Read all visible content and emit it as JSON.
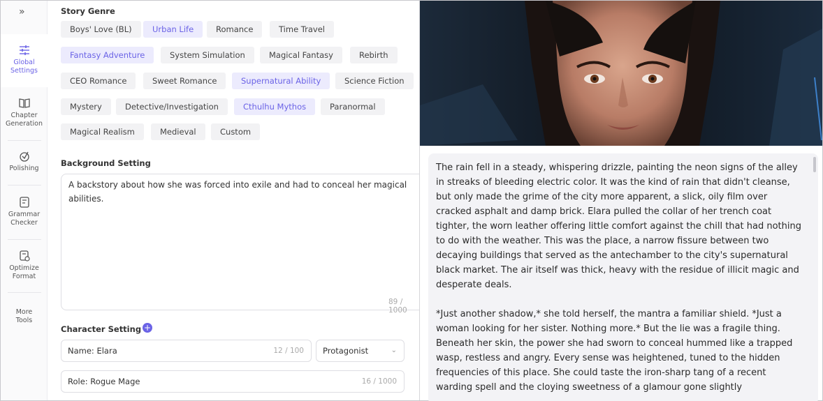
{
  "sidebar": {
    "items": [
      {
        "label_line1": "Global",
        "label_line2": "Settings",
        "icon": "sliders-icon"
      },
      {
        "label_line1": "Chapter",
        "label_line2": "Generation",
        "icon": "book-icon"
      },
      {
        "label_line1": "Polishing",
        "label_line2": "",
        "icon": "magic-icon"
      },
      {
        "label_line1": "Grammar",
        "label_line2": "Checker",
        "icon": "document-check-icon"
      },
      {
        "label_line1": "Optimize",
        "label_line2": "Format",
        "icon": "format-icon"
      },
      {
        "label_line1": "More",
        "label_line2": "Tools",
        "icon": "more-icon"
      }
    ]
  },
  "genre": {
    "title": "Story Genre",
    "chips": [
      "Boys' Love (BL)",
      "Urban Life",
      "Romance",
      "Time Travel",
      "Fantasy Adventure",
      "System Simulation",
      "Magical Fantasy",
      "Rebirth",
      "CEO Romance",
      "Sweet Romance",
      "Supernatural Ability",
      "Science Fiction",
      "Mystery",
      "Detective/Investigation",
      "Cthulhu Mythos",
      "Paranormal",
      "Magical Realism",
      "Medieval",
      "Custom"
    ]
  },
  "background": {
    "title": "Background Setting",
    "text": "A backstory about how she was forced into exile and had to conceal her magical abilities.",
    "counter": "89 / 1000"
  },
  "character": {
    "title": "Character Setting",
    "name": "Name: Elara",
    "name_counter": "12 / 100",
    "role_select": "Protagonist",
    "role": "Role: Rogue Mage",
    "role_counter": "16 / 1000"
  },
  "story": {
    "paragraphs": [
      "The rain fell in a steady, whispering drizzle, painting the neon signs of the alley in streaks of bleeding electric color. It was the kind of rain that didn't cleanse, but only made the grime of the city more apparent, a slick, oily film over cracked asphalt and damp brick. Elara pulled the collar of her trench coat tighter, the worn leather offering little comfort against the chill that had nothing to do with the weather. This was the place, a narrow fissure between two decaying buildings that served as the antechamber to the city's supernatural black market. The air itself was thick, heavy with the residue of illicit magic and desperate deals.",
      "*Just another shadow,* she told herself, the mantra a familiar shield. *Just a woman looking for her sister. Nothing more.* But the lie was a fragile thing. Beneath her skin, the power she had sworn to conceal hummed like a trapped wasp, restless and angry. Every sense was heightened, tuned to the hidden frequencies of this place. She could taste the iron-sharp tang of a recent warding spell and the cloying sweetness of a glamour gone slightly"
    ]
  },
  "colors": {
    "accent": "#6b63e6",
    "chip_bg": "#f2f2f4",
    "chip_selected_bg": "#ecebfd"
  }
}
